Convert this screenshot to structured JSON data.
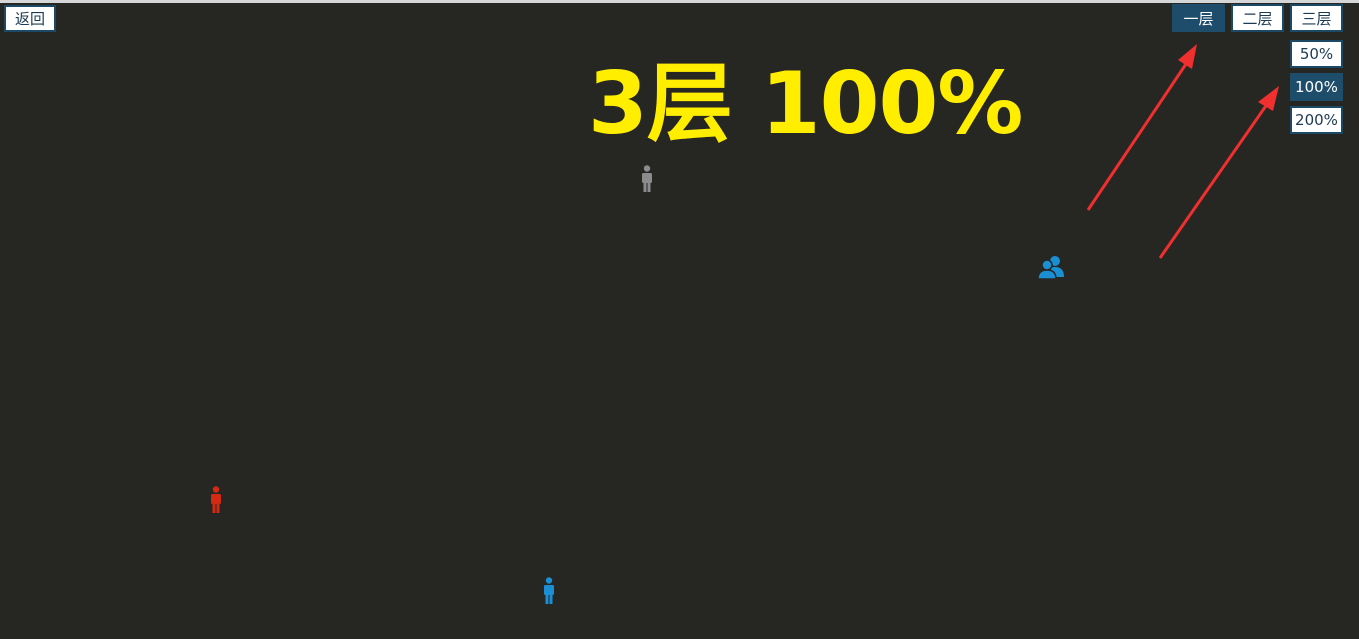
{
  "back_button": {
    "label": "返回"
  },
  "floors": [
    {
      "label": "一层",
      "active": true
    },
    {
      "label": "二层",
      "active": false
    },
    {
      "label": "三层",
      "active": false
    }
  ],
  "zoom_levels": [
    {
      "label": "50%",
      "active": false
    },
    {
      "label": "100%",
      "active": true
    },
    {
      "label": "200%",
      "active": false
    }
  ],
  "overlay_caption": "3层 100%",
  "markers": [
    {
      "type": "person-icon",
      "color": "#8c8c8c"
    },
    {
      "type": "group-icon",
      "color": "#1a8fd4"
    },
    {
      "type": "person-icon",
      "color": "#d42a12"
    },
    {
      "type": "person-icon",
      "color": "#1a8fd4"
    }
  ],
  "colors": {
    "background": "#262622",
    "active_button": "#1e4d6b",
    "caption": "#ffee00",
    "arrow": "#f02f2f"
  }
}
